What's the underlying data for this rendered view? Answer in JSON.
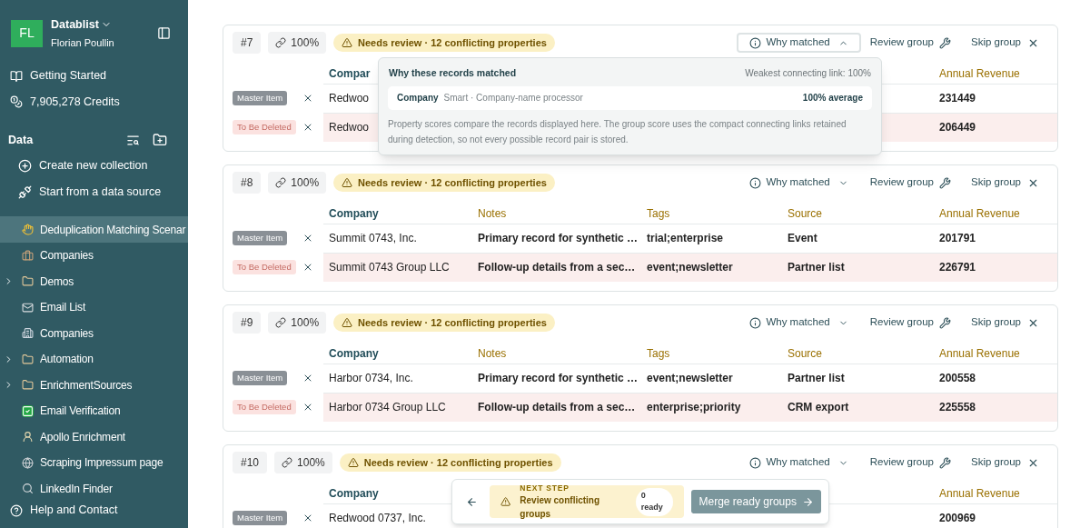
{
  "sidebar": {
    "workspace": {
      "initials": "FL",
      "name": "Datablist",
      "user": "Florian Poullin"
    },
    "top_links": [
      {
        "label": "Getting Started"
      },
      {
        "label": "7,905,278 Credits"
      }
    ],
    "section": {
      "title": "Data"
    },
    "actions": [
      {
        "label": "Create new collection"
      },
      {
        "label": "Start from a data source"
      }
    ],
    "collections": [
      {
        "label": "Deduplication Matching Scenar",
        "kind": "item",
        "selected": true
      },
      {
        "label": "Companies",
        "kind": "item",
        "selected": false
      },
      {
        "label": "Demos",
        "kind": "folder",
        "expanded": false,
        "selected": false
      },
      {
        "label": "Email List",
        "kind": "item",
        "selected": false
      },
      {
        "label": "Companies",
        "kind": "item",
        "selected": false
      },
      {
        "label": "Automation",
        "kind": "folder",
        "expanded": false,
        "selected": false
      },
      {
        "label": "EnrichmentSources",
        "kind": "folder",
        "expanded": false,
        "selected": false
      },
      {
        "label": "Email Verification",
        "kind": "item",
        "selected": false
      },
      {
        "label": "Apollo Enrichment",
        "kind": "item",
        "selected": false
      },
      {
        "label": "Scraping Impressum page",
        "kind": "item",
        "selected": false
      },
      {
        "label": "LinkedIn Finder",
        "kind": "item",
        "selected": false
      }
    ],
    "help": {
      "label": "Help and Contact"
    }
  },
  "groups": [
    {
      "number": "#7",
      "score": "100%",
      "status": "Needs review · 12 conflicting properties",
      "why_matched": {
        "label": "Why matched",
        "expanded": true,
        "details": {
          "title": "Why these records matched",
          "weakest": "Weakest connecting link: 100%",
          "property": "Company",
          "method": "Smart · Company-name processor",
          "score": "100% average",
          "note": "Property scores compare the records displayed here. The group score uses the compact connecting links retained during detection, so not every possible record pair is stored."
        }
      },
      "review": "Review group",
      "skip": "Skip group",
      "columns": [
        {
          "kind": "company",
          "label": "Compar"
        },
        {
          "kind": "revenue",
          "label": "Annual Revenue"
        }
      ],
      "rows": [
        {
          "kind": "master",
          "role": "Master Item",
          "cells": [
            "Redwoo",
            "231449"
          ]
        },
        {
          "kind": "delete",
          "role": "To Be Deleted",
          "cells": [
            "Redwoo",
            "206449"
          ]
        }
      ]
    },
    {
      "number": "#8",
      "score": "100%",
      "status": "Needs review · 12 conflicting properties",
      "why_matched": {
        "label": "Why matched",
        "expanded": false
      },
      "review": "Review group",
      "skip": "Skip group",
      "columns": [
        {
          "kind": "company",
          "label": "Company"
        },
        {
          "kind": "notes",
          "label": "Notes"
        },
        {
          "kind": "tags",
          "label": "Tags"
        },
        {
          "kind": "source",
          "label": "Source"
        },
        {
          "kind": "revenue",
          "label": "Annual Revenue"
        }
      ],
      "rows": [
        {
          "kind": "master",
          "role": "Master Item",
          "cells": [
            "Summit 0743, Inc.",
            "Primary record for synthetic …",
            "trial;enterprise",
            "Event",
            "201791"
          ]
        },
        {
          "kind": "delete",
          "role": "To Be Deleted",
          "cells": [
            "Summit 0743 Group LLC",
            "Follow-up details from a sec…",
            "event;newsletter",
            "Partner list",
            "226791"
          ]
        }
      ]
    },
    {
      "number": "#9",
      "score": "100%",
      "status": "Needs review · 12 conflicting properties",
      "why_matched": {
        "label": "Why matched",
        "expanded": false
      },
      "review": "Review group",
      "skip": "Skip group",
      "columns": [
        {
          "kind": "company",
          "label": "Company"
        },
        {
          "kind": "notes",
          "label": "Notes"
        },
        {
          "kind": "tags",
          "label": "Tags"
        },
        {
          "kind": "source",
          "label": "Source"
        },
        {
          "kind": "revenue",
          "label": "Annual Revenue"
        }
      ],
      "rows": [
        {
          "kind": "master",
          "role": "Master Item",
          "cells": [
            "Harbor 0734, Inc.",
            "Primary record for synthetic …",
            "event;newsletter",
            "Partner list",
            "200558"
          ]
        },
        {
          "kind": "delete",
          "role": "To Be Deleted",
          "cells": [
            "Harbor 0734 Group LLC",
            "Follow-up details from a sec…",
            "enterprise;priority",
            "CRM export",
            "225558"
          ]
        }
      ]
    },
    {
      "number": "#10",
      "score": "100%",
      "status": "Needs review · 12 conflicting properties",
      "why_matched": {
        "label": "Why matched",
        "expanded": false
      },
      "review": "Review group",
      "skip": "Skip group",
      "columns": [
        {
          "kind": "company",
          "label": "Company"
        },
        {
          "kind": "revenue",
          "label": "Annual Revenue"
        }
      ],
      "rows": [
        {
          "kind": "master",
          "role": "Master Item",
          "cells": [
            "Redwood 0737, Inc.",
            "200969"
          ]
        }
      ]
    }
  ],
  "next_step": {
    "eyebrow": "NEXT STEP",
    "title": "Review conflicting groups",
    "count": "0 ready",
    "merge_button": "Merge ready groups"
  }
}
